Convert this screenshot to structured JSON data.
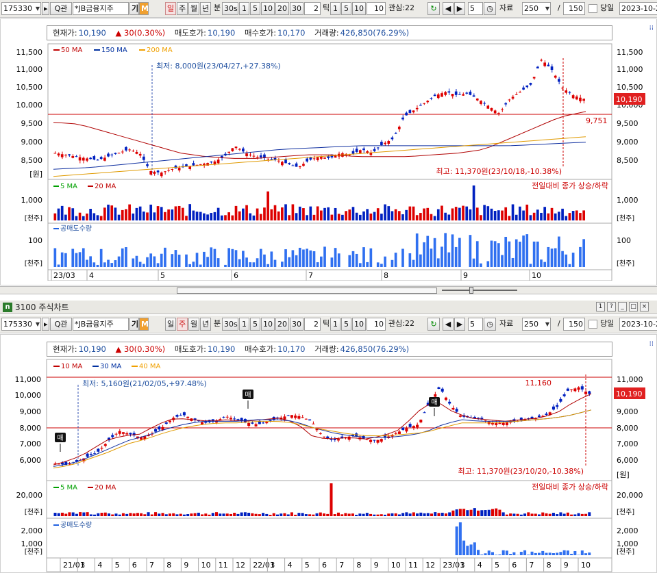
{
  "toolbar": {
    "code": "175330",
    "search_icon_label": "Q관",
    "name": "*JB금융지주",
    "ki_label": "기",
    "m_label": "M",
    "periods": [
      "일",
      "주",
      "월",
      "년"
    ],
    "bun_label": "분",
    "min_sel": "30s",
    "mins": [
      "1",
      "5",
      "10",
      "20",
      "30"
    ],
    "tick_val": "2",
    "tick_label": "틱",
    "ticks": [
      "1",
      "5",
      "10"
    ],
    "ticks_input": "10",
    "gwansim": "관심:22 ",
    "num_val": "5",
    "jaryo_label": "자료",
    "count": "250",
    "slash": "/",
    "total": "150",
    "dangil_label": "당일",
    "date": "2023-10-2"
  },
  "window2": {
    "title": "3100 주식차트",
    "logo_letter": "n"
  },
  "top": {
    "period_selected": "일",
    "info": {
      "cur_label": "현재가:",
      "cur": "10,190",
      "chg": "▲ 30(0.30%)",
      "ask_label": "매도호가:",
      "ask": "10,190",
      "bid_label": "매수호가:",
      "bid": "10,170",
      "vol_label": "거래량:",
      "vol": "426,850(76.29%)"
    },
    "legend_ma": [
      {
        "name": "50 MA",
        "color": "#c00000"
      },
      {
        "name": "150 MA",
        "color": "#0030a0"
      },
      {
        "name": "200 MA",
        "color": "#f0a000"
      }
    ],
    "price_axis": [
      "11,500",
      "11,000",
      "10,500",
      "10,000",
      "9,500",
      "9,000",
      "8,500"
    ],
    "price_unit": "[원]",
    "low_note": "최저: 8,000원(23/04/27,+27.38%)",
    "high_note": "최고: 11,370원(23/10/18,-10.38%)",
    "cur_badge": "10,190",
    "line_value": "9,751",
    "vol_legend": [
      {
        "name": "5 MA",
        "color": "#00a000"
      },
      {
        "name": "20 MA",
        "color": "#c00000"
      }
    ],
    "vol_note": "전일대비 종가 상승/하락",
    "vol_axis": [
      "1,000"
    ],
    "vol_unit": "[천주]",
    "short_legend": "공매도수량",
    "short_axis": [
      "100"
    ],
    "short_unit": "[천주]",
    "x_labels": [
      "23/03",
      "4",
      "5",
      "6",
      "7",
      "8",
      "9",
      "10"
    ]
  },
  "bottom": {
    "period_selected": "주",
    "info": {
      "cur_label": "현재가:",
      "cur": "10,190",
      "chg": "▲ 30(0.30%)",
      "ask_label": "매도호가:",
      "ask": "10,190",
      "bid_label": "매수호가:",
      "bid": "10,170",
      "vol_label": "거래량:",
      "vol": "426,850(76.29%)"
    },
    "legend_ma": [
      {
        "name": "10 MA",
        "color": "#c00000"
      },
      {
        "name": "30 MA",
        "color": "#0030a0"
      },
      {
        "name": "40 MA",
        "color": "#f0a000"
      }
    ],
    "price_axis": [
      "11,000",
      "10,000",
      "9,000",
      "8,000",
      "7,000",
      "6,000"
    ],
    "price_unit": "[원]",
    "low_note": "최저: 5,160원(21/02/05,+97.48%)",
    "high_note": "최고: 11,370원(23/10/20,-10.38%)",
    "high_line_value": "11,160",
    "cur_badge": "10,190",
    "buy_marker": "매",
    "vol_legend": [
      {
        "name": "5 MA",
        "color": "#00a000"
      },
      {
        "name": "20 MA",
        "color": "#c00000"
      }
    ],
    "vol_note": "전일대비 종가 상승/하락",
    "vol_axis": [
      "20,000"
    ],
    "vol_unit": "[천주]",
    "short_legend": "공매도수량",
    "short_axis": [
      "2,000",
      "1,000"
    ],
    "short_unit": "[천주]",
    "x_labels": [
      "21/01",
      "3",
      "4",
      "5",
      "6",
      "7",
      "8",
      "9",
      "10",
      "11",
      "12",
      "22/01",
      "3",
      "4",
      "5",
      "6",
      "7",
      "8",
      "9",
      "10",
      "11",
      "12",
      "23/01",
      "3",
      "4",
      "5",
      "6",
      "7",
      "8",
      "9",
      "10"
    ]
  }
}
